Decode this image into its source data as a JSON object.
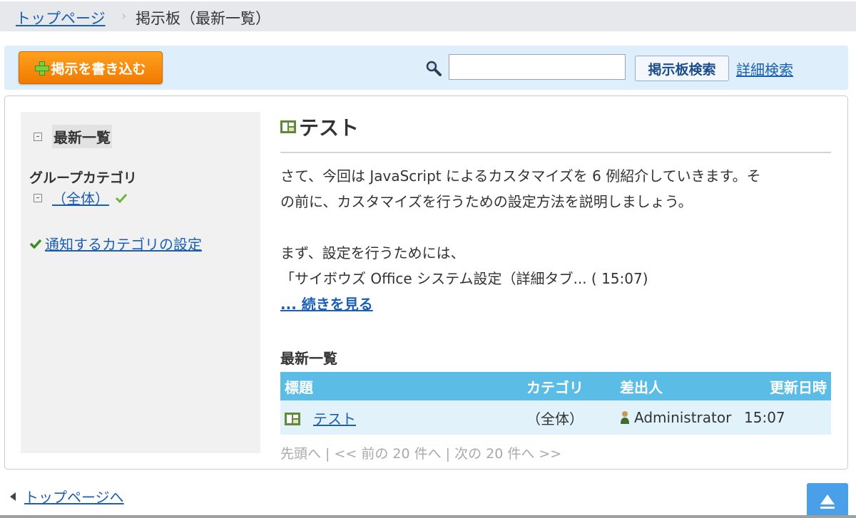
{
  "breadcrumb": {
    "home": "トップページ",
    "separator": "›",
    "current": "掲示板（最新一覧）"
  },
  "toolbar": {
    "post_button": "掲示を書き込む",
    "search_placeholder": "",
    "search_button": "掲示板検索",
    "advanced_search": "詳細検索"
  },
  "sidebar": {
    "latest": "最新一覧",
    "group_title": "グループカテゴリ",
    "all_category": "（全体）",
    "notify_settings": "通知するカテゴリの設定"
  },
  "post": {
    "title": "テスト",
    "line1": "さて、今回は JavaScript によるカスタマイズを 6 例紹介していきます。そ",
    "line2": "の前に、カスタマイズを行うための設定方法を説明しましょう。",
    "line3": "まず、設定を行うためには、",
    "line4": "「サイボウズ Office システム設定（詳細タブ... ( 15:07)",
    "read_more": "... 続きを見る"
  },
  "list": {
    "heading": "最新一覧",
    "columns": {
      "title": "標題",
      "category": "カテゴリ",
      "sender": "差出人",
      "updated": "更新日時"
    },
    "rows": [
      {
        "title": "テスト",
        "category": "（全体）",
        "sender": "Administrator",
        "updated": "15:07"
      }
    ],
    "pager": "先頭へ | << 前の 20 件へ | 次の 20 件へ >>"
  },
  "footer": {
    "back_to_top": "トップページへ"
  },
  "icons": {
    "search": "search-icon",
    "board": "board-icon",
    "check": "check-icon",
    "user": "user-icon",
    "scroll_top": "arrow-up-icon"
  },
  "colors": {
    "accent_orange": "#f08a00",
    "table_header": "#5bbde6",
    "toolbar_bg": "#dfeefb"
  }
}
